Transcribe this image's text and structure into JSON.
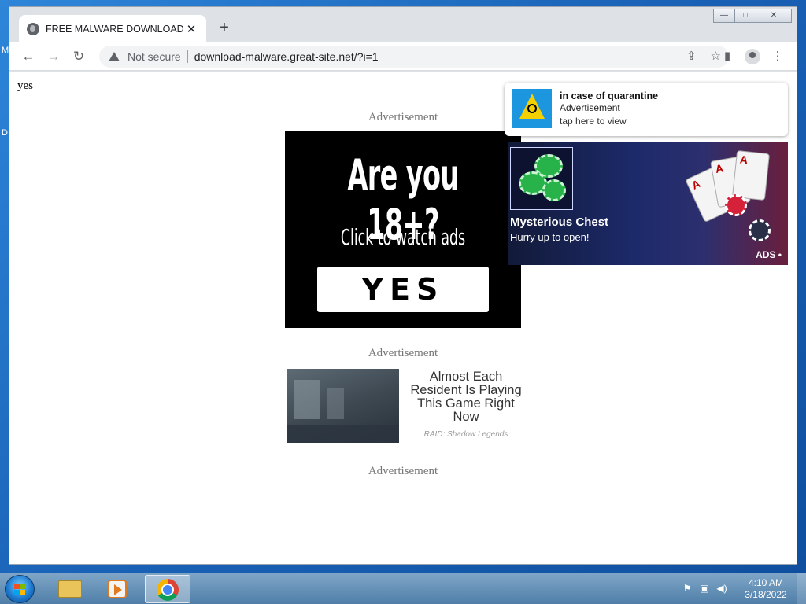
{
  "desktop": {
    "left_letters": [
      "M",
      "D"
    ]
  },
  "browser": {
    "tab": {
      "title": "FREE MALWARE DOWNLOAD",
      "close": "✕"
    },
    "new_tab": "+",
    "window_controls": {
      "minimize": "—",
      "maximize": "□",
      "close": "✕"
    },
    "toolbar": {
      "back": "←",
      "forward": "→",
      "reload": "↻",
      "security_label": "Not secure",
      "url": "download-malware.great-site.net/?i=1",
      "icons": [
        "share-icon",
        "star-icon",
        "side-panel-icon",
        "profile-icon",
        "menu-icon"
      ],
      "menu": "⋮"
    }
  },
  "page": {
    "yes_text": "yes",
    "ad_label": "Advertisement",
    "banner18": {
      "headline": "Are you 18+?",
      "subline": "Click to watch ads",
      "button": "YES"
    },
    "chest_ad": {
      "title": "Mysterious Chest",
      "subtitle": "Hurry up to open!",
      "tag": "ADS •"
    },
    "notification": {
      "title": "in case of quarantine",
      "subtitle": "Advertisement",
      "action": "tap here to view"
    },
    "native_ad": {
      "title": "Almost Each Resident Is Playing This Game Right Now",
      "source": "RAID: Shadow Legends"
    }
  },
  "taskbar": {
    "clock_time": "4:10 AM",
    "clock_date": "3/18/2022",
    "apps": [
      "windows-explorer",
      "media-player",
      "google-chrome"
    ]
  },
  "colors": {
    "accent": "#1a73e8",
    "taskbar": "#4f7ea8",
    "banner_bg": "#000000",
    "notif_icon_bg": "#1d96e0"
  }
}
